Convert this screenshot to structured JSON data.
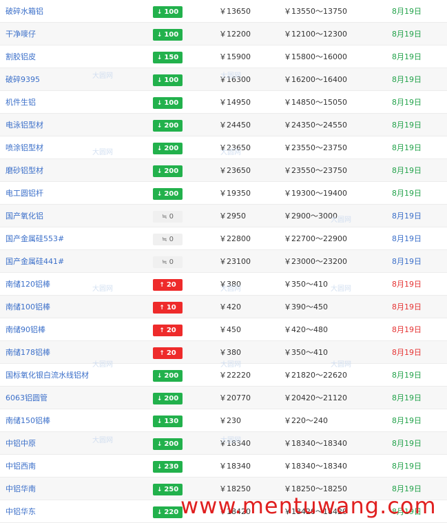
{
  "rows": [
    {
      "name": "破碎水箱铝",
      "dir": "down",
      "change": "100",
      "price": "￥13650",
      "range": "￥13550～13750",
      "date": "8月19日"
    },
    {
      "name": "干净嘜仔",
      "dir": "down",
      "change": "100",
      "price": "￥12200",
      "range": "￥12100～12300",
      "date": "8月19日"
    },
    {
      "name": "割胶铝皮",
      "dir": "down",
      "change": "150",
      "price": "￥15900",
      "range": "￥15800～16000",
      "date": "8月19日"
    },
    {
      "name": "破碎9395",
      "dir": "down",
      "change": "100",
      "price": "￥16300",
      "range": "￥16200～16400",
      "date": "8月19日"
    },
    {
      "name": "机件生铝",
      "dir": "down",
      "change": "100",
      "price": "￥14950",
      "range": "￥14850～15050",
      "date": "8月19日"
    },
    {
      "name": "电泳铝型材",
      "dir": "down",
      "change": "200",
      "price": "￥24450",
      "range": "￥24350～24550",
      "date": "8月19日"
    },
    {
      "name": "喷涂铝型材",
      "dir": "down",
      "change": "200",
      "price": "￥23650",
      "range": "￥23550～23750",
      "date": "8月19日"
    },
    {
      "name": "磨砂铝型材",
      "dir": "down",
      "change": "200",
      "price": "￥23650",
      "range": "￥23550～23750",
      "date": "8月19日"
    },
    {
      "name": "电工圆铝杆",
      "dir": "down",
      "change": "200",
      "price": "￥19350",
      "range": "￥19300～19400",
      "date": "8月19日"
    },
    {
      "name": "国产氧化铝",
      "dir": "flat",
      "change": "0",
      "price": "￥2950",
      "range": "￥2900～3000",
      "date": "8月19日"
    },
    {
      "name": "国产金属硅553#",
      "dir": "flat",
      "change": "0",
      "price": "￥22800",
      "range": "￥22700～22900",
      "date": "8月19日"
    },
    {
      "name": "国产金属硅441#",
      "dir": "flat",
      "change": "0",
      "price": "￥23100",
      "range": "￥23000～23200",
      "date": "8月19日"
    },
    {
      "name": "南储120铝棒",
      "dir": "up",
      "change": "20",
      "price": "￥380",
      "range": "￥350～410",
      "date": "8月19日"
    },
    {
      "name": "南储100铝棒",
      "dir": "up",
      "change": "10",
      "price": "￥420",
      "range": "￥390～450",
      "date": "8月19日"
    },
    {
      "name": "南储90铝棒",
      "dir": "up",
      "change": "20",
      "price": "￥450",
      "range": "￥420～480",
      "date": "8月19日"
    },
    {
      "name": "南储178铝棒",
      "dir": "up",
      "change": "20",
      "price": "￥380",
      "range": "￥350～410",
      "date": "8月19日"
    },
    {
      "name": "国标氧化银白流水线铝材",
      "dir": "down",
      "change": "200",
      "price": "￥22220",
      "range": "￥21820～22620",
      "date": "8月19日"
    },
    {
      "name": "6063铝圆管",
      "dir": "down",
      "change": "200",
      "price": "￥20770",
      "range": "￥20420～21120",
      "date": "8月19日"
    },
    {
      "name": "南储150铝棒",
      "dir": "down",
      "change": "130",
      "price": "￥230",
      "range": "￥220～240",
      "date": "8月19日"
    },
    {
      "name": "中铝中原",
      "dir": "down",
      "change": "200",
      "price": "￥18340",
      "range": "￥18340～18340",
      "date": "8月19日"
    },
    {
      "name": "中铝西南",
      "dir": "down",
      "change": "230",
      "price": "￥18340",
      "range": "￥18340～18340",
      "date": "8月19日"
    },
    {
      "name": "中铝华南",
      "dir": "down",
      "change": "250",
      "price": "￥18250",
      "range": "￥18250～18250",
      "date": "8月19日"
    },
    {
      "name": "中铝华东",
      "dir": "down",
      "change": "220",
      "price": "￥18420",
      "range": "￥18420～18420",
      "date": "8月19日"
    }
  ],
  "arrows": {
    "down": "↓",
    "up": "↑",
    "flat": "≒"
  },
  "colors": {
    "down": "#22b14c",
    "up": "#ee2b2b",
    "flat": "#f0f0f0"
  },
  "watermark_text": "www.mentuwang.com",
  "logo_watermark": "大圆网"
}
